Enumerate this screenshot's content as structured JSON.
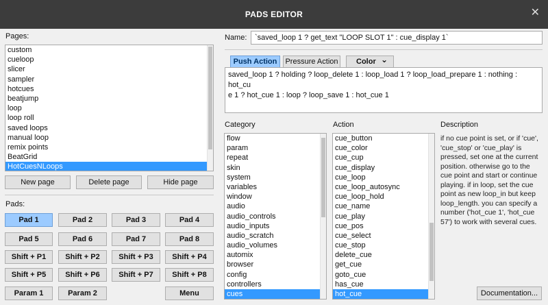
{
  "window": {
    "title": "PADS EDITOR",
    "close_glyph": "✕"
  },
  "pages": {
    "label": "Pages:",
    "items": [
      "custom",
      "cueloop",
      "slicer",
      "sampler",
      "hotcues",
      "beatjump",
      "loop",
      "loop roll",
      "saved loops",
      "manual loop",
      "remix points",
      "BeatGrid",
      "HotCuesNLoops"
    ],
    "selected_index": 12,
    "buttons": {
      "new": "New page",
      "delete": "Delete page",
      "hide": "Hide page"
    }
  },
  "pads": {
    "label": "Pads:",
    "rows": [
      [
        "Pad 1",
        "Pad 2",
        "Pad 3",
        "Pad 4"
      ],
      [
        "Pad 5",
        "Pad 6",
        "Pad 7",
        "Pad 8"
      ],
      [
        "Shift + P1",
        "Shift + P2",
        "Shift + P3",
        "Shift + P4"
      ],
      [
        "Shift + P5",
        "Shift + P6",
        "Shift + P7",
        "Shift + P8"
      ]
    ],
    "selected": "Pad 1",
    "param1": "Param 1",
    "param2": "Param 2",
    "menu": "Menu"
  },
  "name": {
    "label": "Name:",
    "value": "`saved_loop 1 ? get_text \"LOOP SLOT 1\" : cue_display 1`"
  },
  "tabs": {
    "push": "Push Action",
    "pressure": "Pressure Action",
    "color": "Color",
    "color_arrow": "⌄",
    "active": "push"
  },
  "script": {
    "line1": "saved_loop 1 ? holding ? loop_delete 1 : loop_load 1 ? loop_load_prepare 1 : nothing : hot_cu",
    "line2": "e 1 ? hot_cue 1 : loop ? loop_save 1 : hot_cue 1"
  },
  "category": {
    "label": "Category",
    "items": [
      "flow",
      "param",
      "repeat",
      "skin",
      "system",
      "variables",
      "window",
      "audio",
      "audio_controls",
      "audio_inputs",
      "audio_scratch",
      "audio_volumes",
      "automix",
      "browser",
      "config",
      "controllers",
      "cues"
    ],
    "selected_index": 16
  },
  "action": {
    "label": "Action",
    "items": [
      "cue_button",
      "cue_color",
      "cue_cup",
      "cue_display",
      "cue_loop",
      "cue_loop_autosync",
      "cue_loop_hold",
      "cue_name",
      "cue_play",
      "cue_pos",
      "cue_select",
      "cue_stop",
      "delete_cue",
      "get_cue",
      "goto_cue",
      "has_cue",
      "hot_cue"
    ],
    "selected_index": 16
  },
  "description": {
    "label": "Description",
    "lines": [
      "if no cue point is set, or if 'cue',",
      "'cue_stop' or 'cue_play' is",
      "pressed, set one at the current",
      "position. otherwise go to the",
      "cue point and start or continue",
      "playing. if in loop, set the cue",
      "point as new loop_in but keep",
      "loop_length. you can specify a",
      "number ('hot_cue 1', 'hot_cue",
      "57') to work with several cues."
    ]
  },
  "documentation_button": "Documentation..."
}
